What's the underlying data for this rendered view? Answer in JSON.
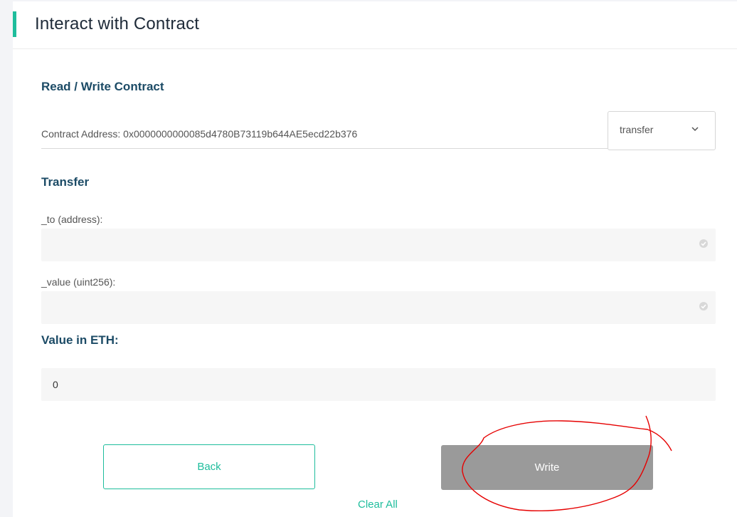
{
  "header": {
    "title": "Interact with Contract"
  },
  "section": {
    "title": "Read / Write Contract"
  },
  "contract": {
    "address_label": "Contract Address: 0x0000000000085d4780B73119b644AE5ecd22b376",
    "function_select": "transfer"
  },
  "function": {
    "title": "Transfer"
  },
  "params": [
    {
      "label": "_to (address):",
      "value": "",
      "icon": "check-circle-icon"
    },
    {
      "label": "_value (uint256):",
      "value": "",
      "icon": "check-circle-icon"
    }
  ],
  "value_eth": {
    "label": "Value in ETH:",
    "value": "0"
  },
  "actions": {
    "back": "Back",
    "write": "Write",
    "clear_all": "Clear All"
  },
  "colors": {
    "accent": "#1ebd9c",
    "heading": "#1c4b66",
    "write_button": "#9a9a9a",
    "annotation": "#e60000"
  }
}
